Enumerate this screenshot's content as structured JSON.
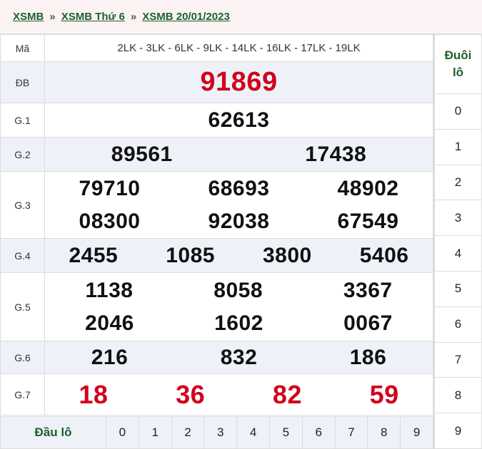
{
  "breadcrumb": {
    "items": [
      "XSMB",
      "XSMB Thứ 6",
      "XSMB 20/01/2023"
    ],
    "separator": "»"
  },
  "table": {
    "ma": {
      "label": "Mã",
      "value": "2LK - 3LK - 6LK - 9LK - 14LK - 16LK - 17LK - 19LK"
    },
    "db": {
      "label": "ĐB",
      "numbers": [
        "91869"
      ]
    },
    "g1": {
      "label": "G.1",
      "numbers": [
        "62613"
      ]
    },
    "g2": {
      "label": "G.2",
      "numbers": [
        "89561",
        "17438"
      ]
    },
    "g3": {
      "label": "G.3",
      "numbers": [
        "79710",
        "68693",
        "48902",
        "08300",
        "92038",
        "67549"
      ]
    },
    "g4": {
      "label": "G.4",
      "numbers": [
        "2455",
        "1085",
        "3800",
        "5406"
      ]
    },
    "g5": {
      "label": "G.5",
      "numbers": [
        "1138",
        "8058",
        "3367",
        "2046",
        "1602",
        "0067"
      ]
    },
    "g6": {
      "label": "G.6",
      "numbers": [
        "216",
        "832",
        "186"
      ]
    },
    "g7": {
      "label": "G.7",
      "numbers": [
        "18",
        "36",
        "82",
        "59"
      ]
    }
  },
  "dau_lo": {
    "label": "Đầu lô",
    "digits": [
      "0",
      "1",
      "2",
      "3",
      "4",
      "5",
      "6",
      "7",
      "8",
      "9"
    ]
  },
  "duoi_lo": {
    "label_line1": "Đuôi",
    "label_line2": "lô",
    "digits": [
      "0",
      "1",
      "2",
      "3",
      "4",
      "5",
      "6",
      "7",
      "8",
      "9"
    ]
  },
  "colors": {
    "accent_green": "#1f5f2c",
    "special_red": "#d0021b",
    "row_alt": "#eef1f8",
    "header_bg": "#fbf3f3"
  }
}
